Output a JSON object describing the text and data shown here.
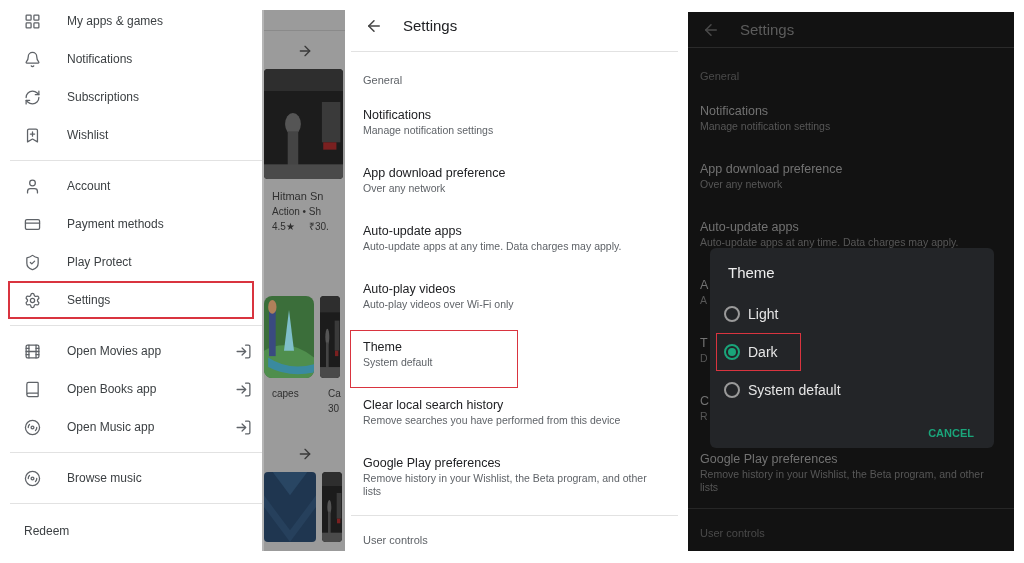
{
  "drawer": {
    "sections": [
      {
        "items": [
          {
            "label": "My apps & games",
            "external": false,
            "highlighted": false
          },
          {
            "label": "Notifications",
            "external": false,
            "highlighted": false
          },
          {
            "label": "Subscriptions",
            "external": false,
            "highlighted": false
          },
          {
            "label": "Wishlist",
            "external": false,
            "highlighted": false
          }
        ]
      },
      {
        "items": [
          {
            "label": "Account",
            "external": false,
            "highlighted": false
          },
          {
            "label": "Payment methods",
            "external": false,
            "highlighted": false
          },
          {
            "label": "Play Protect",
            "external": false,
            "highlighted": false
          },
          {
            "label": "Settings",
            "external": false,
            "highlighted": true
          }
        ]
      },
      {
        "items": [
          {
            "label": "Open Movies app",
            "external": true,
            "highlighted": false
          },
          {
            "label": "Open Books app",
            "external": true,
            "highlighted": false
          },
          {
            "label": "Open Music app",
            "external": true,
            "highlighted": false
          }
        ]
      },
      {
        "items": [
          {
            "label": "Browse music",
            "external": false,
            "highlighted": false
          }
        ]
      }
    ],
    "footer": "Redeem"
  },
  "background_page": {
    "app_title": "Hitman Sn",
    "app_meta": "Action • Sh",
    "rating": "4.5★",
    "price": "₹30.",
    "card_1_title": "capes",
    "card_2_title": "Ca",
    "card_2_meta": "30"
  },
  "settings_light": {
    "title": "Settings",
    "heading": "General",
    "items": [
      {
        "title": "Notifications",
        "subtitle": "Manage notification settings",
        "highlighted": false
      },
      {
        "title": "App download preference",
        "subtitle": "Over any network",
        "highlighted": false
      },
      {
        "title": "Auto-update apps",
        "subtitle": "Auto-update apps at any time. Data charges may apply.",
        "highlighted": false
      },
      {
        "title": "Auto-play videos",
        "subtitle": "Auto-play videos over Wi-Fi only",
        "highlighted": false
      },
      {
        "title": "Theme",
        "subtitle": "System default",
        "highlighted": true
      },
      {
        "title": "Clear local search history",
        "subtitle": "Remove searches you have performed from this device",
        "highlighted": false
      },
      {
        "title": "Google Play preferences",
        "subtitle": "Remove history in your Wishlist, the Beta program, and other lists",
        "highlighted": false
      }
    ],
    "footer_heading": "User controls"
  },
  "settings_dark": {
    "title": "Settings",
    "heading": "General",
    "items": [
      {
        "title": "Notifications",
        "subtitle": "Manage notification settings"
      },
      {
        "title": "App download preference",
        "subtitle": "Over any network"
      },
      {
        "title": "Auto-update apps",
        "subtitle": "Auto-update apps at any time. Data charges may apply."
      },
      {
        "title": "A",
        "subtitle": "A"
      },
      {
        "title": "T",
        "subtitle": "D"
      },
      {
        "title": "C",
        "subtitle": "R"
      },
      {
        "title": "Google Play preferences",
        "subtitle": "Remove history in your Wishlist, the Beta program, and other lists"
      }
    ],
    "footer_heading": "User controls",
    "dialog": {
      "title": "Theme",
      "options": [
        {
          "label": "Light",
          "selected": false,
          "highlighted": false
        },
        {
          "label": "Dark",
          "selected": true,
          "highlighted": true
        },
        {
          "label": "System default",
          "selected": false,
          "highlighted": false
        }
      ],
      "button": "CANCEL"
    }
  }
}
